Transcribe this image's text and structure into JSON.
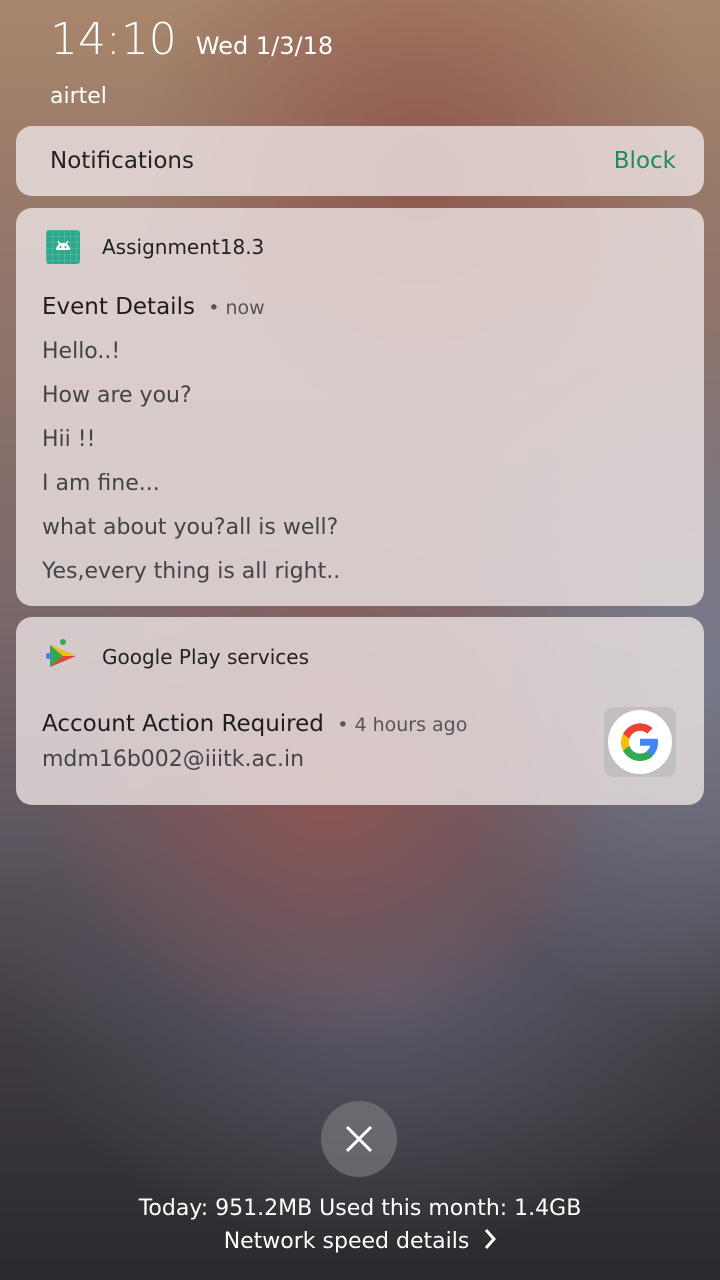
{
  "status": {
    "time": "14:10",
    "date": "Wed 1/3/18",
    "carrier": "airtel"
  },
  "notification_header": {
    "title": "Notifications",
    "action": "Block",
    "action_color": "#1f8a5a"
  },
  "app_notification": {
    "app_name": "Assignment18.3",
    "icon": "android-icon",
    "title": "Event Details",
    "time": "• now",
    "lines": [
      "Hello..!",
      "How are you?",
      "Hii !!",
      "I am fine...",
      "what about you?all is well?",
      "Yes,every thing is all right.."
    ]
  },
  "gps_notification": {
    "app_name": "Google Play services",
    "icon": "puzzle-icon",
    "title": "Account Action Required",
    "time": "• 4 hours ago",
    "text": "mdm16b002@iiitk.ac.in",
    "large_icon": "google-g-icon"
  },
  "footer": {
    "data_usage": "Today: 951.2MB Used this month: 1.4GB",
    "network_link": "Network speed details"
  }
}
